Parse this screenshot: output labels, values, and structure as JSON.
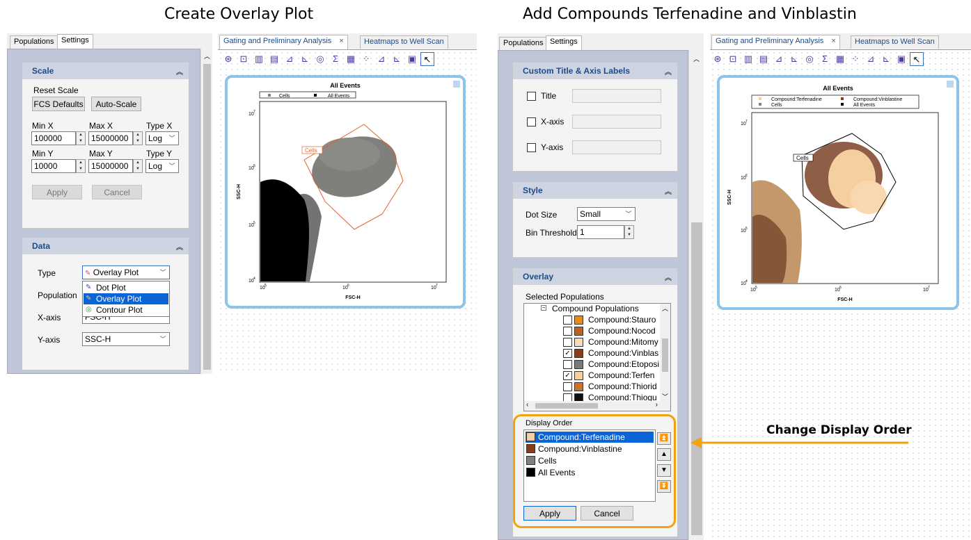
{
  "headings": {
    "left": "Create Overlay Plot",
    "right": "Add Compounds Terfenadine and Vinblastin",
    "callout": "Change Display Order"
  },
  "colors": {
    "accent": "#0a64d6",
    "callout_border": "#f0a30a",
    "group_title": "#1d4a86",
    "cells_gate": "#e2622a",
    "terfenadine": "#f5cf9f",
    "vinblastine": "#8b3a1a",
    "cells": "#808080",
    "all_events": "#000000",
    "plot_frame": "#8ec3ea"
  },
  "left": {
    "side_tabs": [
      "Populations",
      "Settings"
    ],
    "doc_tabs": [
      "Gating and Preliminary Analysis",
      "Heatmaps to Well Scan"
    ],
    "scale": {
      "title": "Scale",
      "reset_label": "Reset Scale",
      "fcs_defaults": "FCS Defaults",
      "auto_scale": "Auto-Scale",
      "min_x_label": "Min X",
      "max_x_label": "Max X",
      "type_x_label": "Type X",
      "min_x": "100000",
      "max_x": "15000000",
      "type_x": "Log",
      "min_y_label": "Min Y",
      "max_y_label": "Max Y",
      "type_y_label": "Type Y",
      "min_y": "10000",
      "max_y": "15000000",
      "type_y": "Log",
      "apply": "Apply",
      "cancel": "Cancel"
    },
    "data": {
      "title": "Data",
      "type_label": "Type",
      "type_value": "Overlay Plot",
      "type_options": [
        "Dot Plot",
        "Overlay Plot",
        "Contour Plot"
      ],
      "population_label": "Population",
      "xaxis_label": "X-axis",
      "xaxis_value": "FSC-H",
      "yaxis_label": "Y-axis",
      "yaxis_value": "SSC-H"
    },
    "plot": {
      "title": "All Events",
      "legend": [
        "Cells",
        "All Events"
      ],
      "gate_label": "Cells",
      "xlabel": "FSC-H",
      "ylabel": "SSC-H"
    }
  },
  "right": {
    "side_tabs": [
      "Populations",
      "Settings"
    ],
    "doc_tabs": [
      "Gating and Preliminary Analysis",
      "Heatmaps to Well Scan"
    ],
    "custom": {
      "title": "Custom Title & Axis Labels",
      "title_cb": "Title",
      "xaxis_cb": "X-axis",
      "yaxis_cb": "Y-axis"
    },
    "style": {
      "title": "Style",
      "dot_size_label": "Dot Size",
      "dot_size": "Small",
      "bin_label": "Bin Threshold",
      "bin_value": "1"
    },
    "overlay": {
      "title": "Overlay",
      "selected_label": "Selected Populations",
      "tree_root": "Compound Populations",
      "tree_items": [
        {
          "label": "Compound:Stauro",
          "checked": false,
          "color": "#e8891c"
        },
        {
          "label": "Compound:Nocod",
          "checked": false,
          "color": "#b5652a"
        },
        {
          "label": "Compound:Mitomy",
          "checked": false,
          "color": "#f7dcb8"
        },
        {
          "label": "Compound:Vinblas",
          "checked": true,
          "color": "#8b3a1a"
        },
        {
          "label": "Compound:Etoposi",
          "checked": false,
          "color": "#7a7a7a"
        },
        {
          "label": "Compound:Terfen",
          "checked": true,
          "color": "#f5cf9f"
        },
        {
          "label": "Compound:Thiorid",
          "checked": false,
          "color": "#c8742e"
        },
        {
          "label": "Compound:Thiogu",
          "checked": false,
          "color": "#111111"
        }
      ],
      "display_order_label": "Display Order",
      "display_order": [
        {
          "label": "Compound:Terfenadine",
          "color": "#f5cf9f"
        },
        {
          "label": "Compound:Vinblastine",
          "color": "#8b3a1a"
        },
        {
          "label": "Cells",
          "color": "#808080"
        },
        {
          "label": "All Events",
          "color": "#000000"
        }
      ],
      "apply": "Apply",
      "cancel": "Cancel"
    },
    "plot": {
      "title": "All Events",
      "legend": [
        "Compound:Terfenadine",
        "Compound:Vinblastine",
        "Cells",
        "All Events"
      ],
      "gate_label": "Cells",
      "xlabel": "FSC-H",
      "ylabel": "SSC-H"
    }
  },
  "axis_ticks": {
    "x": [
      "10",
      "10",
      "10"
    ],
    "x_exp": [
      "5",
      "6",
      "7"
    ],
    "y": [
      "10",
      "10",
      "10",
      "10"
    ],
    "y_exp": [
      "7",
      "6",
      "5",
      "4"
    ]
  }
}
